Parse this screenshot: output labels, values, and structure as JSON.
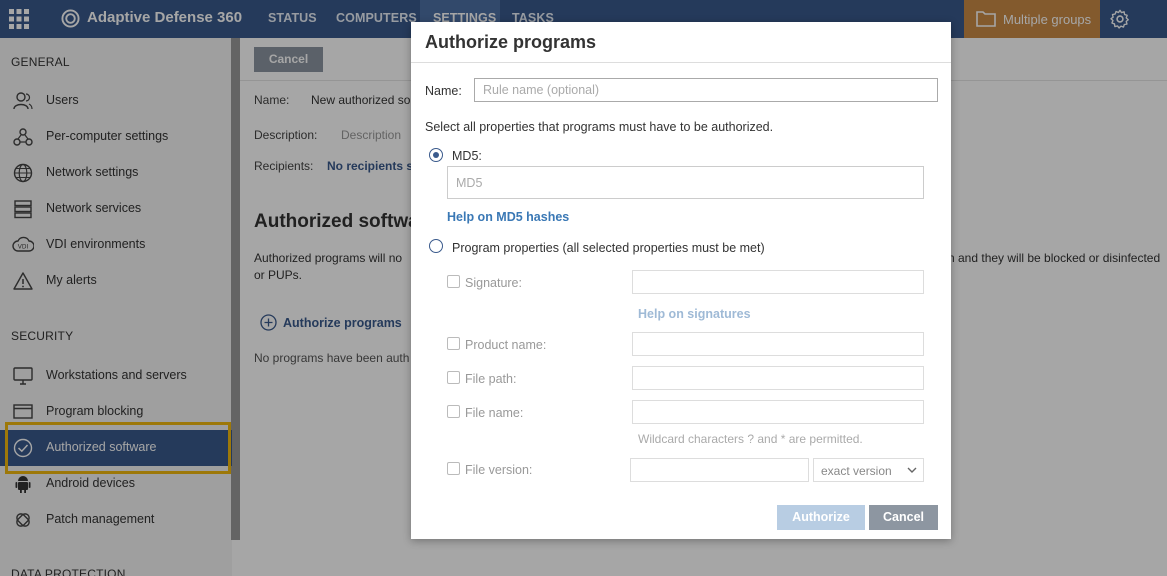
{
  "app": {
    "title": "Adaptive Defense 360",
    "nav_tabs": [
      {
        "label": "STATUS"
      },
      {
        "label": "COMPUTERS"
      },
      {
        "label": "SETTINGS",
        "active": true
      },
      {
        "label": "TASKS"
      }
    ],
    "groups_label": "Multiple groups",
    "colors": {
      "topbar": "#3a5a8c",
      "groups": "#c98a45",
      "highlight": "#f2b90f"
    }
  },
  "sidebar": {
    "general_title": "GENERAL",
    "general_items": [
      {
        "label": "Users",
        "icon": "users-icon"
      },
      {
        "label": "Per-computer settings",
        "icon": "computer-settings-icon"
      },
      {
        "label": "Network settings",
        "icon": "globe-icon"
      },
      {
        "label": "Network services",
        "icon": "server-icon"
      },
      {
        "label": "VDI environments",
        "icon": "vdi-icon"
      },
      {
        "label": "My alerts",
        "icon": "alert-icon"
      }
    ],
    "security_title": "SECURITY",
    "security_items": [
      {
        "label": "Workstations and servers",
        "icon": "monitor-icon"
      },
      {
        "label": "Program blocking",
        "icon": "window-icon"
      },
      {
        "label": "Authorized software",
        "icon": "check-circle-icon",
        "selected": true
      },
      {
        "label": "Android devices",
        "icon": "android-icon"
      },
      {
        "label": "Patch management",
        "icon": "patch-icon"
      }
    ],
    "data_protection_title": "DATA PROTECTION"
  },
  "main": {
    "cancel_label": "Cancel",
    "name_label": "Name:",
    "name_value": "New authorized so",
    "description_label": "Description:",
    "description_value": "Description",
    "recipients_label": "Recipients:",
    "recipients_value": "No recipients s",
    "heading": "Authorized softwa",
    "description_text_1": "Authorized programs will no",
    "description_text_2": "n and they will be blocked or disinfected",
    "description_text_3": "or PUPs.",
    "add_label": "Authorize programs",
    "empty_message": "No programs have been auth"
  },
  "modal": {
    "title": "Authorize programs",
    "name_label": "Name:",
    "name_placeholder": "Rule name (optional)",
    "instruction": "Select all properties that programs must have to be authorized.",
    "md5_label": "MD5:",
    "md5_placeholder": "MD5",
    "md5_help": "Help on MD5 hashes",
    "program_props_label": "Program properties (all selected properties must be met)",
    "signature_label": "Signature:",
    "signature_help": "Help on signatures",
    "product_name_label": "Product name:",
    "file_path_label": "File path:",
    "file_name_label": "File name:",
    "wildcard_note": "Wildcard characters ? and * are permitted.",
    "file_version_label": "File version:",
    "version_select": "exact version",
    "authorize_label": "Authorize",
    "cancel_label": "Cancel"
  }
}
